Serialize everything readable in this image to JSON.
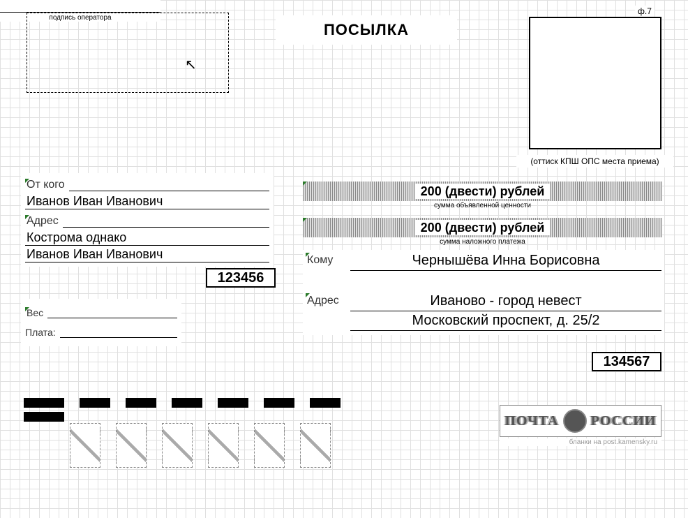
{
  "form_code": "ф.7",
  "title": "ПОСЫЛКА",
  "kpsh_caption": "(оттиск КПШ ОПС места приема)",
  "sender": {
    "from_label": "От кого",
    "from_value": "Иванов Иван Иванович",
    "address_label": "Адрес",
    "address_line1": "Кострома однако",
    "address_line2": "Иванов Иван Иванович",
    "postcode": "123456"
  },
  "weight_label": "Вес",
  "fee_label": "Плата:",
  "operator_sig_caption": "подпись оператора",
  "declared_value": "200 (двести) рублей",
  "declared_caption": "сумма объявленной ценности",
  "cod_value": "200 (двести) рублей",
  "cod_caption": "сумма наложного платежа",
  "recipient": {
    "to_label": "Кому",
    "to_name": "Чернышёва Инна Борисовна",
    "address_label": "Адрес",
    "address_line1": "Иваново - город невест",
    "address_line2": "Московский проспект, д. 25/2",
    "postcode": "134567"
  },
  "logo_left": "ПОЧТА",
  "logo_right": "РОССИИ",
  "logo_sub": "бланки на post.kamensky.ru"
}
